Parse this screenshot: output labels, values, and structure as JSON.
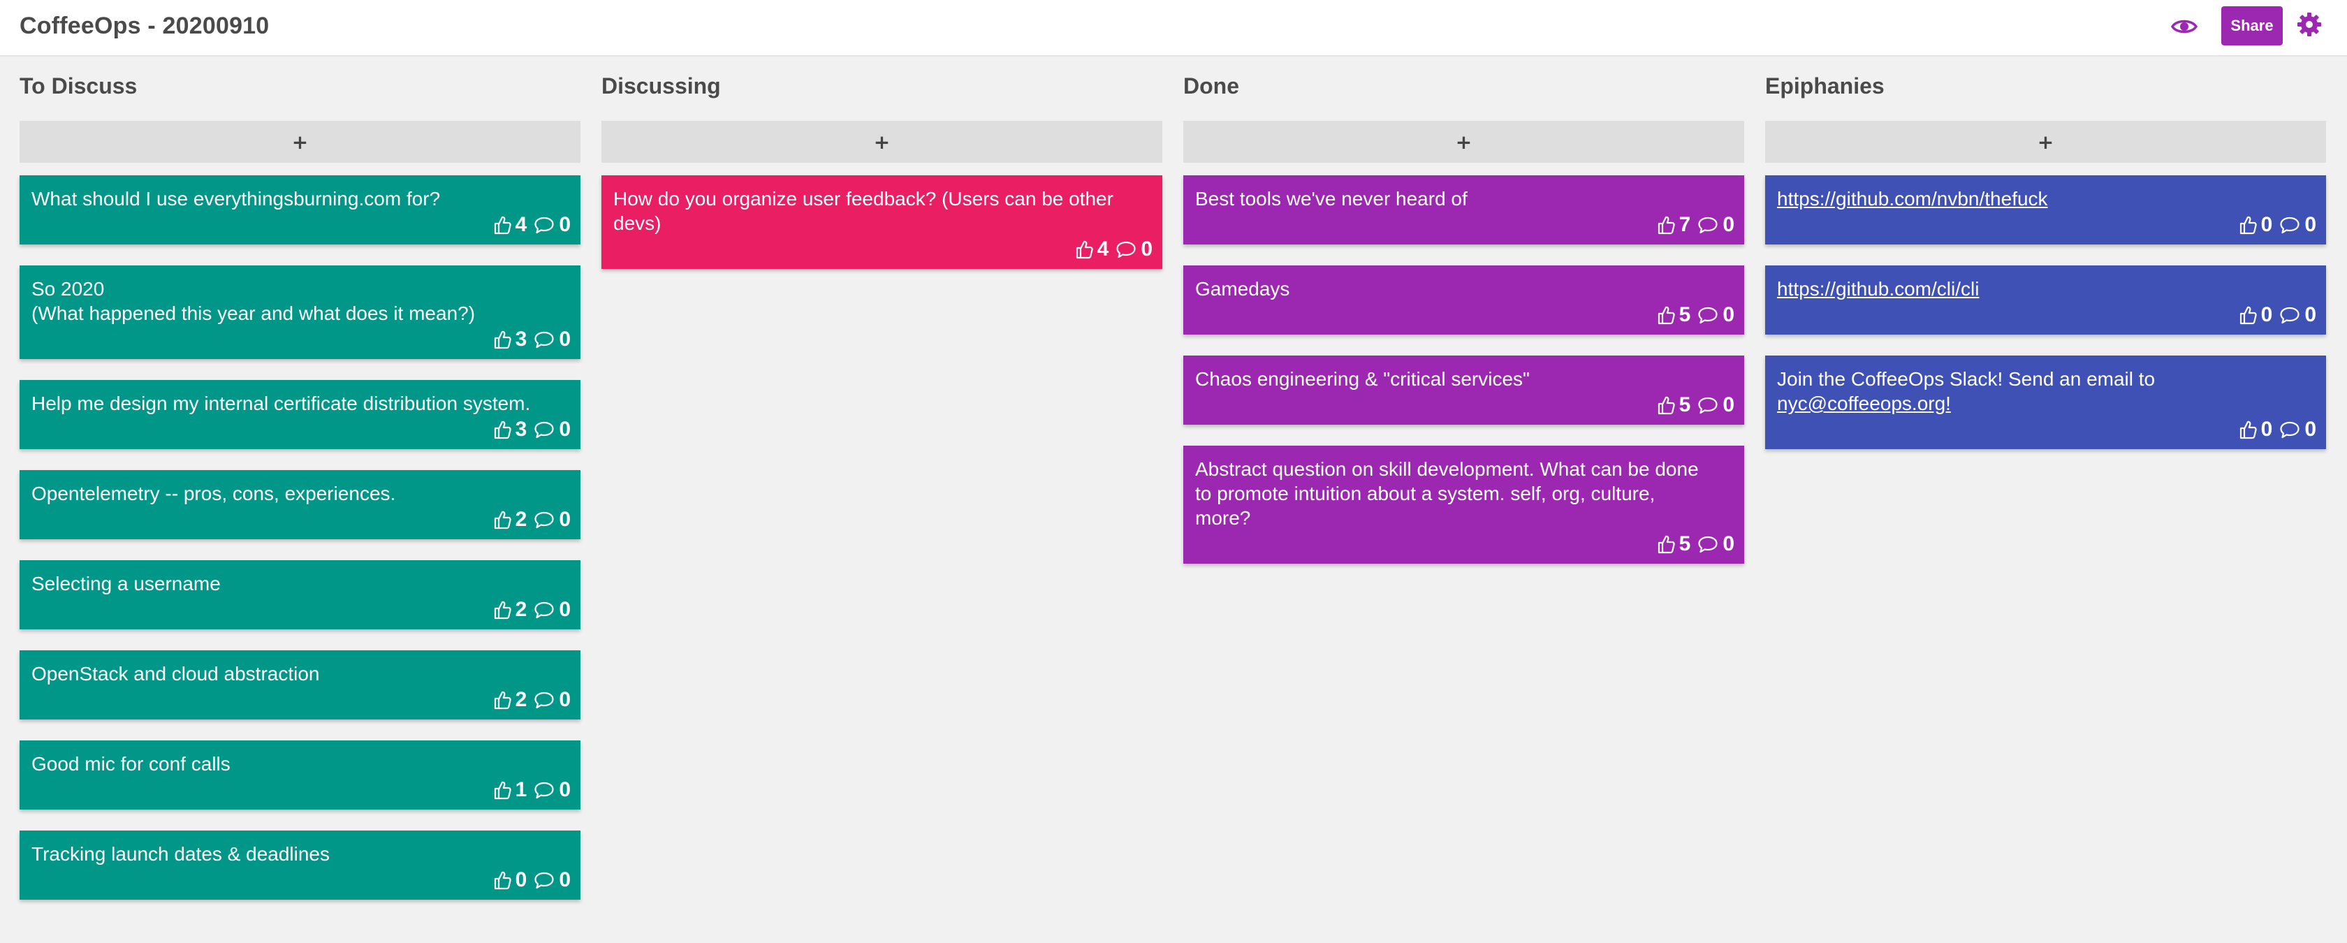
{
  "app": {
    "title": "CoffeeOps - 20200910",
    "share_label": "Share",
    "accent": "#9c27b0"
  },
  "add_label": "+",
  "columns": [
    {
      "title": "To Discuss",
      "color": "#009688",
      "cards": [
        {
          "text": "What should I use everythingsburning.com for?",
          "likes": "4",
          "comments": "0"
        },
        {
          "text": "So 2020\n(What happened this year and what does it mean?)",
          "likes": "3",
          "comments": "0"
        },
        {
          "text": "Help me design my internal certificate distribution system.",
          "likes": "3",
          "comments": "0"
        },
        {
          "text": "Opentelemetry -- pros, cons, experiences.",
          "likes": "2",
          "comments": "0"
        },
        {
          "text": "Selecting a username",
          "likes": "2",
          "comments": "0"
        },
        {
          "text": "OpenStack and cloud abstraction",
          "likes": "2",
          "comments": "0"
        },
        {
          "text": "Good mic for conf calls",
          "likes": "1",
          "comments": "0"
        },
        {
          "text": "Tracking launch dates & deadlines",
          "likes": "0",
          "comments": "0"
        }
      ]
    },
    {
      "title": "Discussing",
      "color": "#e91e63",
      "cards": [
        {
          "text": "How do you organize user feedback? (Users can be other devs)",
          "likes": "4",
          "comments": "0"
        }
      ]
    },
    {
      "title": "Done",
      "color": "#9c27b0",
      "cards": [
        {
          "text": "Best tools we've never heard of",
          "likes": "7",
          "comments": "0"
        },
        {
          "text": "Gamedays",
          "likes": "5",
          "comments": "0"
        },
        {
          "text": "Chaos engineering & \"critical services\"",
          "likes": "5",
          "comments": "0"
        },
        {
          "text": "Abstract question on skill development. What can be done to promote intuition about a system. self, org, culture, more?",
          "likes": "5",
          "comments": "0"
        }
      ]
    },
    {
      "title": "Epiphanies",
      "color": "#3f51b5",
      "cards": [
        {
          "text": "",
          "link": "https://github.com/nvbn/thefuck",
          "likes": "0",
          "comments": "0"
        },
        {
          "text": "",
          "link": "https://github.com/cli/cli",
          "likes": "0",
          "comments": "0"
        },
        {
          "text": "Join the CoffeeOps Slack! Send an email to ",
          "link": "nyc@coffeeops.org!",
          "likes": "0",
          "comments": "0"
        }
      ]
    }
  ]
}
